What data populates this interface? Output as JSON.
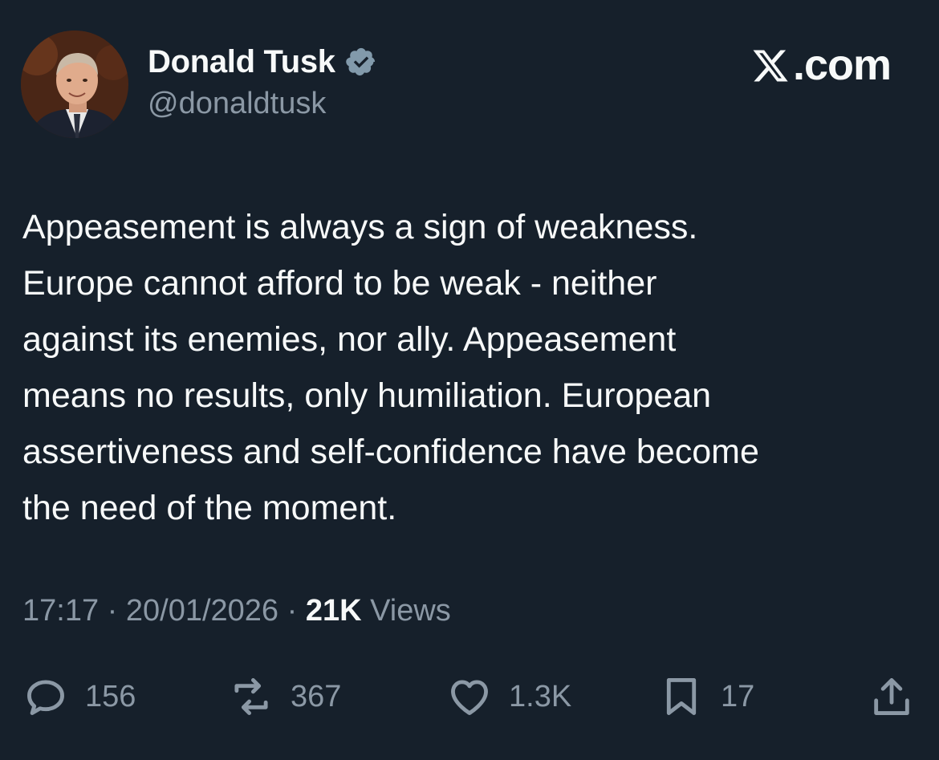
{
  "author": {
    "display_name": "Donald Tusk",
    "handle": "@donaldtusk",
    "verified": true
  },
  "brand": {
    "label": ".com",
    "icon": "x-logo-icon"
  },
  "tweet": {
    "text": "Appeasement is always a sign of weakness.\nEurope cannot afford to be weak - neither\nagainst its enemies, nor ally. Appeasement\nmeans no results, only humiliation. European\nassertiveness and self-confidence have become\nthe need of the moment."
  },
  "meta": {
    "time": "17:17",
    "separator": "·",
    "date": "20/01/2026",
    "views_count": "21K",
    "views_label": "Views"
  },
  "actions": {
    "replies": {
      "icon": "reply-icon",
      "count": "156"
    },
    "reposts": {
      "icon": "repost-icon",
      "count": "367"
    },
    "likes": {
      "icon": "heart-icon",
      "count": "1.3K"
    },
    "bookmarks": {
      "icon": "bookmark-icon",
      "count": "17"
    },
    "share": {
      "icon": "share-icon"
    }
  },
  "colors": {
    "background": "#16202b",
    "text_primary": "#f7f9f9",
    "text_secondary": "#8b98a5",
    "verified_badge": "#829aab"
  }
}
